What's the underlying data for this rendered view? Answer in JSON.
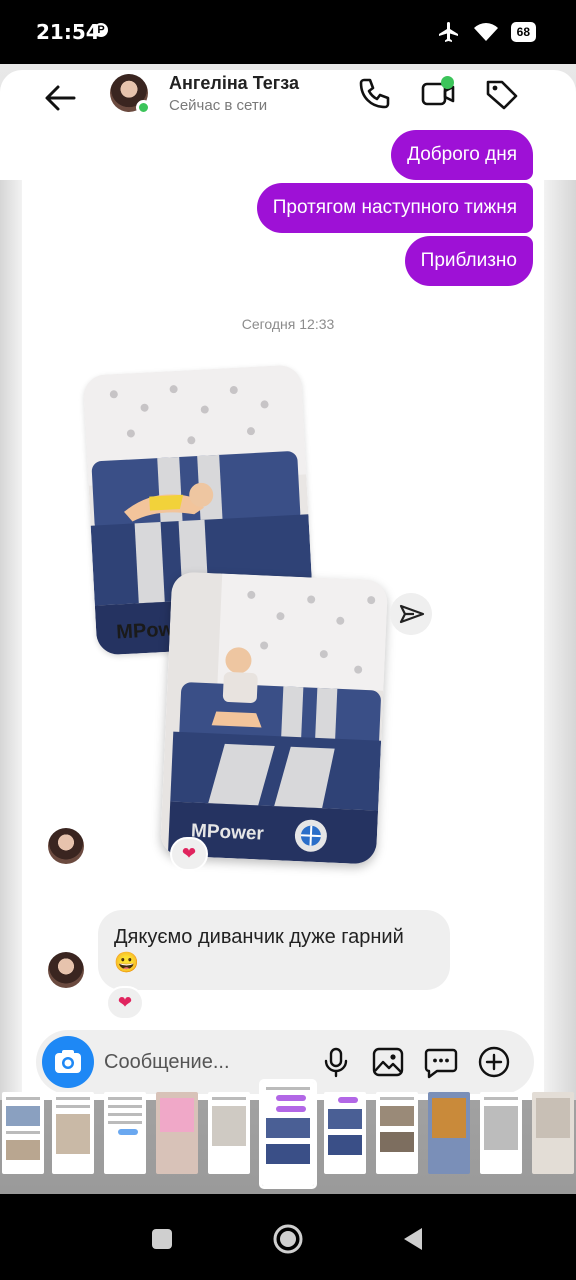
{
  "status_bar": {
    "time": "21:54",
    "notification_icon": "p-badge-icon",
    "battery": "68",
    "icons": [
      "airplane-icon",
      "wifi-icon",
      "battery-icon"
    ]
  },
  "header": {
    "contact_name": "Ангеліна Тегза",
    "contact_status": "Сейчас в сети",
    "icons": [
      "back-arrow-icon",
      "phone-icon",
      "video-call-icon",
      "tag-icon"
    ]
  },
  "messages": {
    "outgoing": [
      "Доброго дня",
      "Протягом наступного тижня",
      "Приблизно"
    ],
    "timestamp": "Сегодня 12:33",
    "incoming_text": "Дякуємо диванчик дуже гарний 😀",
    "photo_logo_1": "MPower",
    "photo_logo_2": "MPower",
    "reaction": "❤"
  },
  "composer": {
    "placeholder": "Сообщение...",
    "icons": [
      "camera-icon",
      "mic-icon",
      "gallery-icon",
      "sticker-icon",
      "plus-icon"
    ]
  },
  "colors": {
    "outgoing_bubble": "#9e11d6",
    "incoming_bubble": "#efefef",
    "camera_button": "#1e88f5",
    "online": "#3cc45a"
  }
}
